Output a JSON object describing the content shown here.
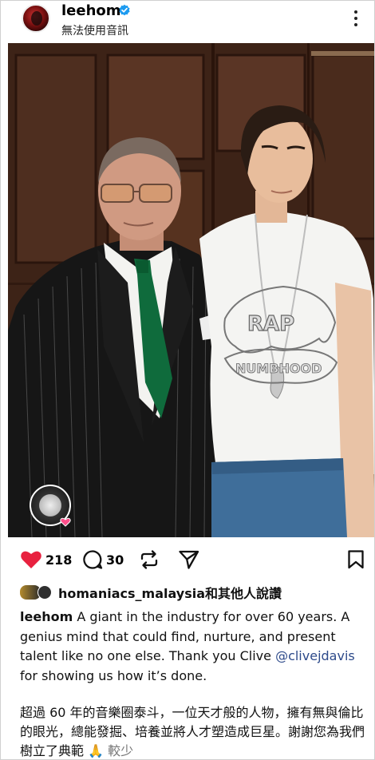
{
  "header": {
    "username": "leehom",
    "subtitle": "無法使用音訊"
  },
  "actions": {
    "likes_count": "218",
    "comments_count": "30"
  },
  "liked_by": {
    "text": "homaniacs_malaysia和其他人說讚"
  },
  "caption": {
    "username": "leehom",
    "text_before": " A giant in the industry for over 60 years. A genius mind that could find, nurture, and present talent like no one else. Thank you Clive ",
    "mention": "@clivejdavis",
    "text_after": " for showing us how it’s done.",
    "zh_text": "超過 60 年的音樂圈泰斗，一位天才般的人物，擁有無與倫比的眼光，總能發掘、培養並將人才塑造成巨星。謝謝您為我們樹立了典範 🙏 ",
    "less_label": "較少"
  },
  "colors": {
    "heart": "#e8213f",
    "mention": "#2d4a8a",
    "verified": "#1d9bf0"
  }
}
